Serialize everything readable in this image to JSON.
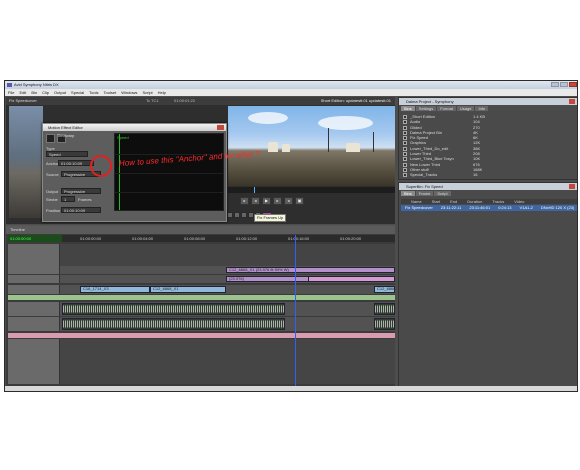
{
  "window": {
    "title": "Avid Symphony Nitris DX"
  },
  "menu": [
    "File",
    "Edit",
    "Bin",
    "Clip",
    "Output",
    "Special",
    "Tools",
    "Toolset",
    "Windows",
    "Script",
    "Help"
  ],
  "composer": {
    "title": "Fix Speedcover",
    "tc_label": "Tc TC1",
    "tc_value": "01:00:01:22",
    "seq_label": "Short Edition: updatestt.01 updatestt.01"
  },
  "mee": {
    "title": "Motion Effect Editor",
    "thumb_label": "Timewarp",
    "type_label": "Type",
    "type_value": "Speed",
    "anchor_label": "Anchor",
    "anchor_value": "01:00:10:09",
    "source_label": "Source",
    "source_value": "Progressive",
    "output_label": "Output",
    "output_value": "Progressive",
    "strobe_label": "Strobe",
    "strobe_value": "1",
    "frames_label": "Frames",
    "graph_label": "Speed",
    "position_label": "Position",
    "position_value": "01:00:10:09"
  },
  "annotation": "How to use this \"Anchor\" and for what ?",
  "tooltip": "Fix Frames Up",
  "bin": {
    "title": "Dalma Project - Symphony",
    "tabs": [
      "Bins",
      "Settings",
      "Format",
      "Usage",
      "Info"
    ],
    "rows": [
      {
        "name": "_Short Edition",
        "size": "1.4 KB"
      },
      {
        "name": "Audio",
        "size": "104"
      },
      {
        "name": "Gilded",
        "size": "270"
      },
      {
        "name": "Dalma Project Bin",
        "size": "4K"
      },
      {
        "name": "Fix Speed",
        "size": "6K"
      },
      {
        "name": "Graphics",
        "size": "12K"
      },
      {
        "name": "Lower_Third_Do_edit",
        "size": "38K"
      },
      {
        "name": "Lower Third",
        "size": "208"
      },
      {
        "name": "Lower_Third_Blue Tcsyn",
        "size": "10K"
      },
      {
        "name": "New Lower Third",
        "size": "676"
      },
      {
        "name": "Other stuff",
        "size": "188K"
      },
      {
        "name": "Special_Tracks",
        "size": "16"
      }
    ]
  },
  "superbin": {
    "title": "SuperBin: Fix Speed",
    "tabs": [
      "Bins",
      "Frame",
      "Script"
    ],
    "columns": [
      "Name",
      "Start",
      "End",
      "Duration",
      "Tracks",
      "Video"
    ],
    "row": {
      "name": "Fix Speedcover",
      "start": "23:11:22:11",
      "end": "23:11:46:01",
      "duration": "0:24:13",
      "tracks": "V1A1-2",
      "video": "DNxHD 120 X (23)"
    }
  },
  "timeline": {
    "header": "Timeline",
    "tc": "01:00:00:00",
    "ruler": [
      "01:00:00:00",
      "01:00:04:00",
      "01:00:08:00",
      "01:00:12:00",
      "01:00:16:00",
      "01:00:20:00",
      "01:00:24:00"
    ],
    "clips_v2": [
      {
        "label": "C12_6868_X1 (23.976 fit 59% W)",
        "label2": "(23.976)"
      }
    ],
    "clips_v1": [
      {
        "label": "C16_1714_X3"
      },
      {
        "label": "C12_6868_X1"
      },
      {
        "label": "C12_6868_X1"
      }
    ]
  },
  "colors": {
    "accent": "#3d66a3",
    "annotation": "#ff2a2a",
    "panel": "#4a4a4a"
  }
}
